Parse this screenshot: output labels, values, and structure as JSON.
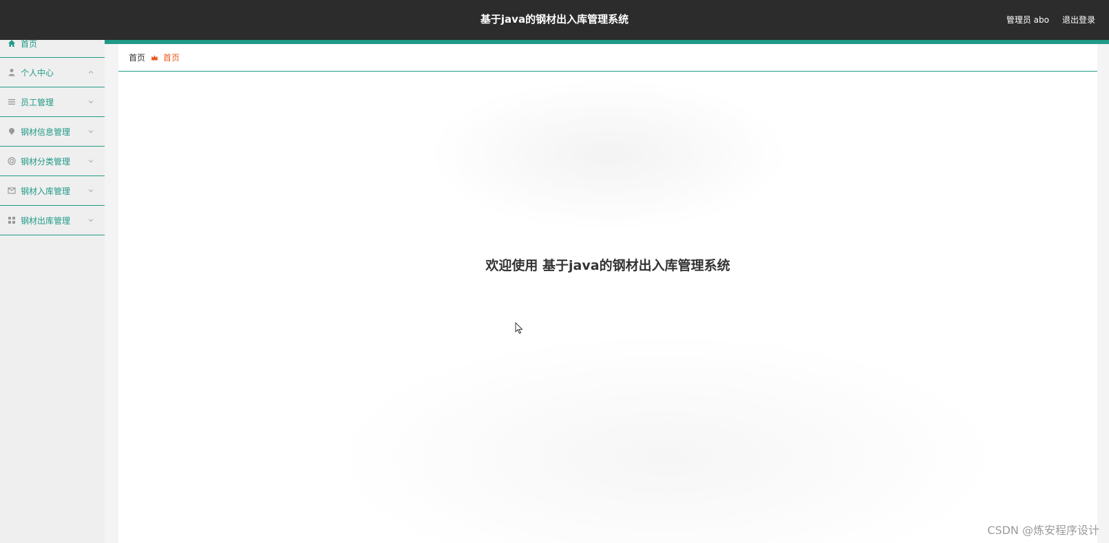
{
  "header": {
    "title": "基于java的钢材出入库管理系统",
    "user_label": "管理员 abo",
    "logout_label": "退出登录"
  },
  "sidebar": {
    "items": [
      {
        "label": "首页",
        "icon": "home-icon"
      },
      {
        "label": "个人中心",
        "icon": "user-icon"
      },
      {
        "label": "员工管理",
        "icon": "list-icon"
      },
      {
        "label": "钢材信息管理",
        "icon": "pin-icon"
      },
      {
        "label": "钢材分类管理",
        "icon": "circle-icon"
      },
      {
        "label": "钢材入库管理",
        "icon": "inbox-icon"
      },
      {
        "label": "钢材出库管理",
        "icon": "grid-icon"
      }
    ]
  },
  "breadcrumb": {
    "root": "首页",
    "current": "首页"
  },
  "main": {
    "welcome": "欢迎使用 基于java的钢材出入库管理系统"
  },
  "watermark": "CSDN @炼安程序设计",
  "colors": {
    "accent": "#1f9a86",
    "header_bg": "#2c2c2c",
    "breadcrumb_active": "#e8591c"
  }
}
